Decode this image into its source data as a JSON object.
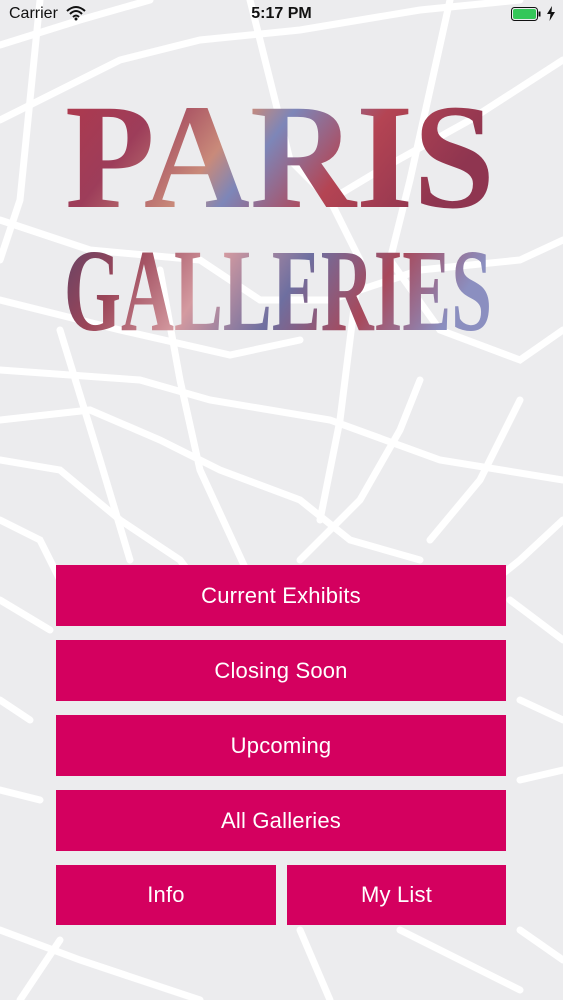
{
  "status_bar": {
    "carrier": "Carrier",
    "time": "5:17 PM",
    "wifi_icon": "wifi-icon",
    "battery_icon": "battery-icon",
    "battery_color": "#34c759"
  },
  "logo": {
    "line1": "PARIS",
    "line2": "GALLERIES"
  },
  "menu": {
    "current_exhibits": "Current Exhibits",
    "closing_soon": "Closing Soon",
    "upcoming": "Upcoming",
    "all_galleries": "All Galleries",
    "info": "Info",
    "my_list": "My List"
  },
  "colors": {
    "button": "#d4005f",
    "background": "#ececee",
    "streets": "#ffffff"
  }
}
